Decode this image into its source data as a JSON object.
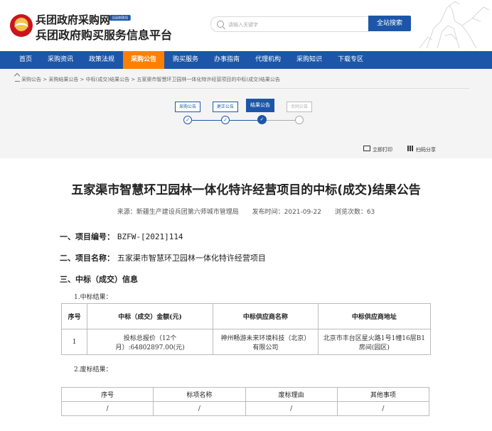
{
  "site": {
    "title_line1": "兵团政府采购网",
    "badge": "兵团财政局",
    "title_line2": "兵团政府购买服务信息平台"
  },
  "search": {
    "placeholder": "请输入关键字",
    "button": "全站搜索"
  },
  "nav": [
    {
      "label": "首页"
    },
    {
      "label": "采购资讯"
    },
    {
      "label": "政策法规"
    },
    {
      "label": "采购公告"
    },
    {
      "label": "购买服务"
    },
    {
      "label": "办事指南"
    },
    {
      "label": "代理机构"
    },
    {
      "label": "采购知识"
    },
    {
      "label": "下载专区"
    }
  ],
  "breadcrumb": "采购公告 > 采购结果公告 > 中标(成交)结果公告 > 五家渠市智慧环卫园林一体化特许经营项目的中标(成交)结果公告",
  "progress": {
    "steps": [
      {
        "label": "采购公告",
        "state": "done"
      },
      {
        "label": "更正公告",
        "state": "done"
      },
      {
        "label": "结果公告",
        "state": "current"
      },
      {
        "label": "合同公告",
        "state": "pending"
      }
    ],
    "check": "✓"
  },
  "tools": {
    "print": "立即打印",
    "share": "扫码分享"
  },
  "article": {
    "title": "五家渠市智慧环卫园林一体化特许经营项目的中标(成交)结果公告",
    "source": "来源：新疆生产建设兵团第六师城市管理局",
    "publish_time": "发布时间：2021-09-22",
    "views": "浏览次数：63",
    "sec1_label": "一、项目编号：",
    "sec1_value": "BZFW-[2021]114",
    "sec2_label": "二、项目名称：",
    "sec2_value": "五家渠市智慧环卫园林一体化特许经营项目",
    "sec3_label": "三、中标（成交）信息",
    "result_label": "1.中标结果：",
    "result_table": {
      "headers": [
        "序号",
        "中标（成交）金额(元)",
        "中标供应商名称",
        "中标供应商地址"
      ],
      "rows": [
        [
          "1",
          "投标总报价（12个月）:64802897.00(元)",
          "神州畅游未来环境科技（北京）有限公司",
          "北京市丰台区星火路1号1幢16层B1房间(园区)"
        ]
      ]
    },
    "abolish_label": "2.废标结果：",
    "abolish_table": {
      "headers": [
        "序号",
        "标项名称",
        "废标理由",
        "其他事项"
      ],
      "rows": [
        [
          "/",
          "/",
          "/",
          "/"
        ]
      ]
    }
  }
}
